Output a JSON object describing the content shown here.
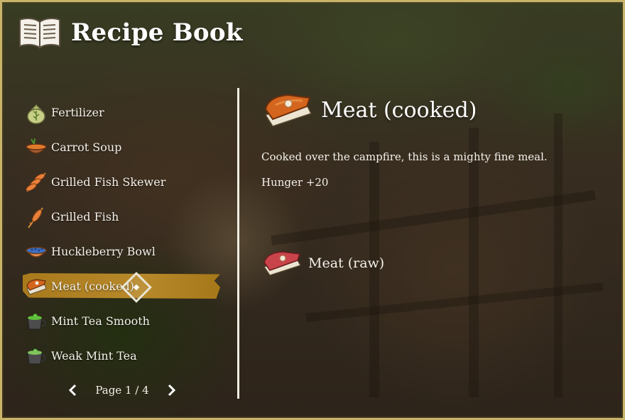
{
  "header": {
    "title": "Recipe Book",
    "icon": "open-book-icon"
  },
  "recipes": [
    {
      "label": "Fertilizer",
      "icon": "fertilizer-sack-icon",
      "selected": false
    },
    {
      "label": "Carrot Soup",
      "icon": "carrot-soup-icon",
      "selected": false
    },
    {
      "label": "Grilled Fish Skewer",
      "icon": "fish-skewer-icon",
      "selected": false
    },
    {
      "label": "Grilled Fish",
      "icon": "grilled-fish-icon",
      "selected": false
    },
    {
      "label": "Huckleberry Bowl",
      "icon": "huckleberry-bowl-icon",
      "selected": false
    },
    {
      "label": "Meat (cooked)",
      "icon": "cooked-meat-icon",
      "selected": true
    },
    {
      "label": "Mint Tea Smooth",
      "icon": "mint-tea-icon",
      "selected": false
    },
    {
      "label": "Weak Mint Tea",
      "icon": "mint-tea-icon",
      "selected": false
    }
  ],
  "pager": {
    "label": "Page 1 / 4",
    "prev_icon": "chevron-left-icon",
    "next_icon": "chevron-right-icon"
  },
  "detail": {
    "title": "Meat (cooked)",
    "icon": "cooked-meat-icon",
    "description": "Cooked over the campfire, this is a mighty fine meal.",
    "stat": "Hunger +20",
    "ingredients": [
      {
        "label": "Meat (raw)",
        "icon": "raw-meat-icon"
      }
    ]
  },
  "colors": {
    "highlight": "#b8892a",
    "text": "#f4f1ea",
    "frame": "#c9b46a"
  }
}
